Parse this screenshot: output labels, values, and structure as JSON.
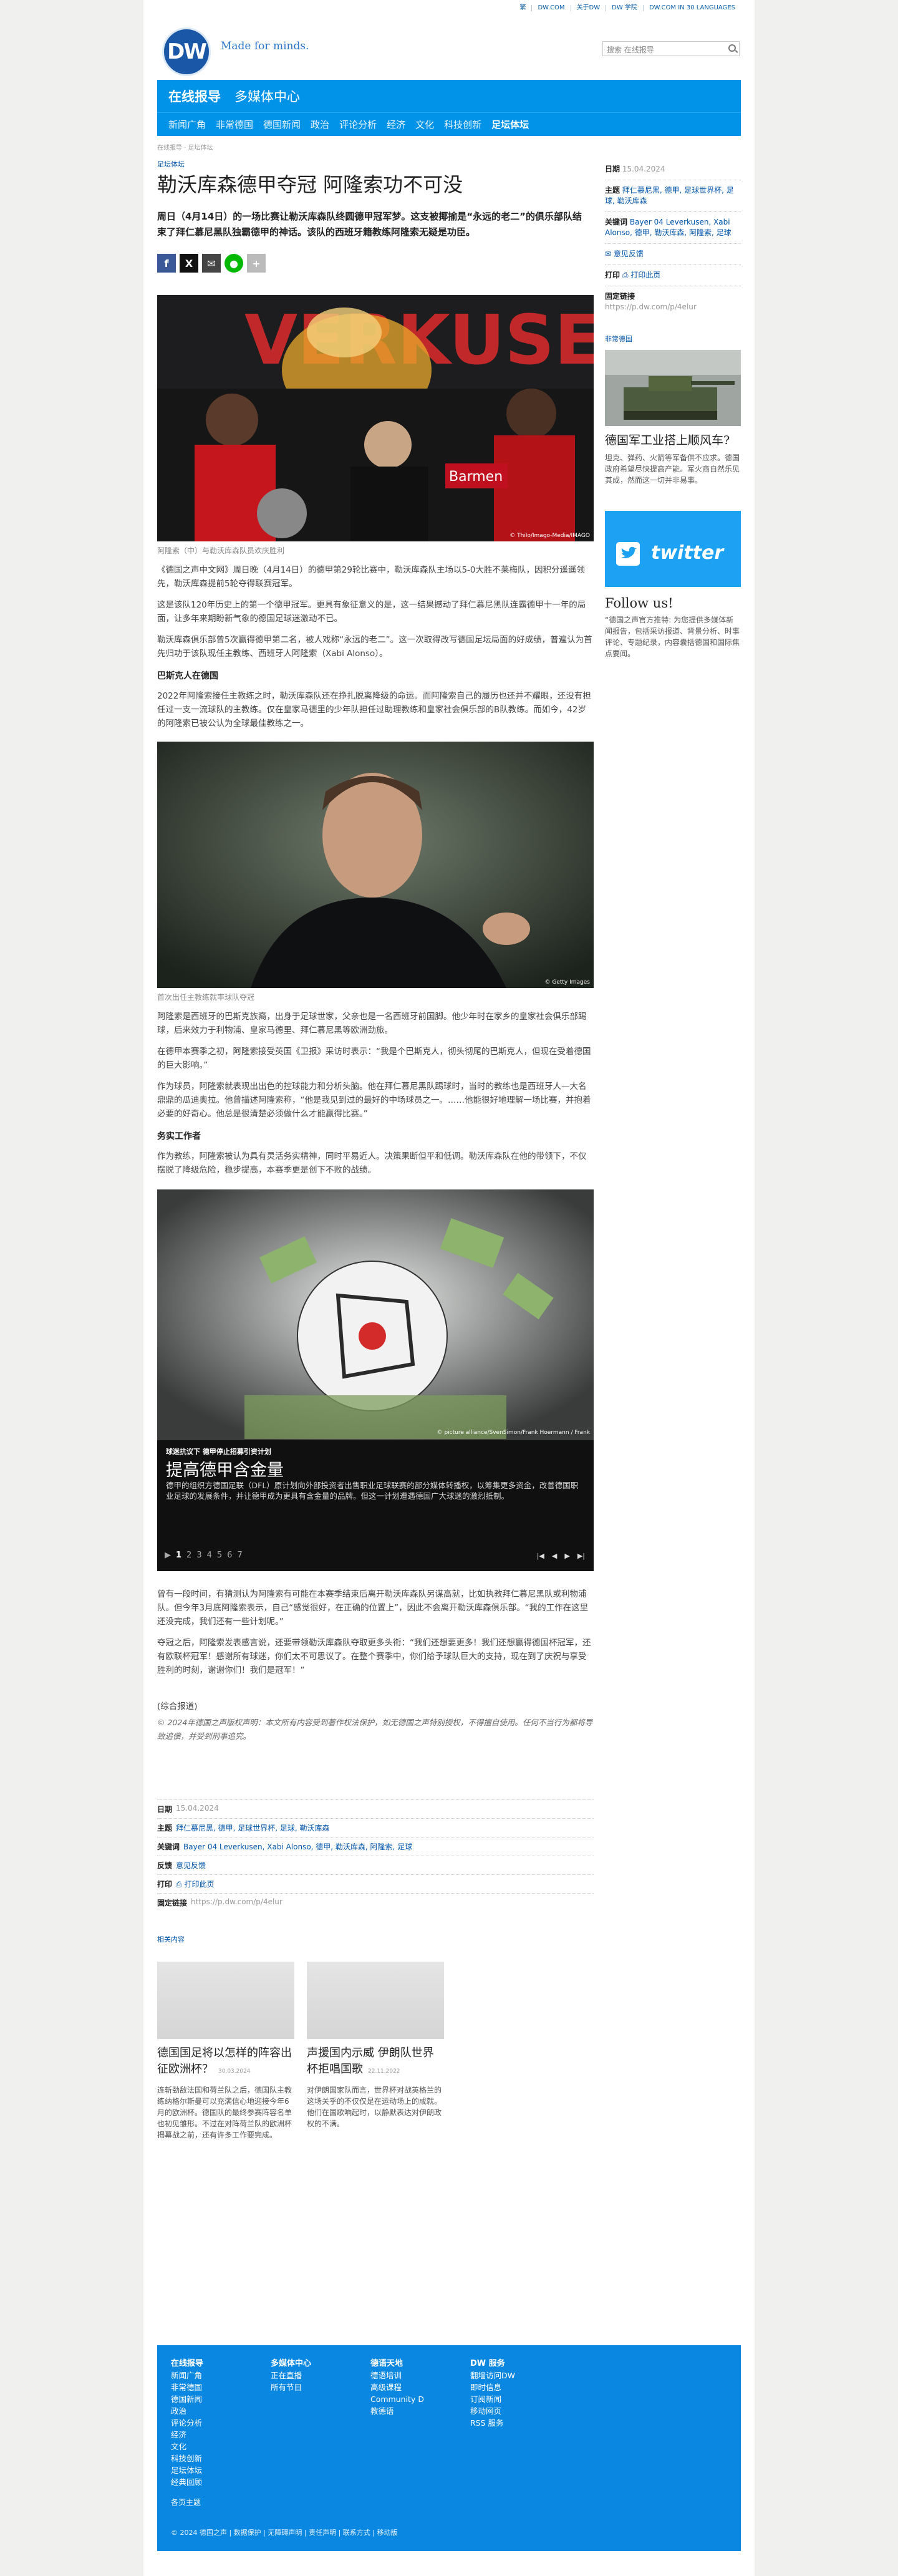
{
  "toplinks": [
    "繁",
    "DW.COM",
    "关于DW",
    "DW 学院",
    "DW.COM IN 30 LANGUAGES"
  ],
  "header": {
    "tagline": "Made for minds.",
    "search_placeholder": "搜索 在线报导",
    "logo": "DW"
  },
  "nav": {
    "top": [
      "在线报导",
      "多媒体中心"
    ],
    "sub": [
      "新闻广角",
      "非常德国",
      "德国新闻",
      "政治",
      "评论分析",
      "经济",
      "文化",
      "科技创新",
      "足坛体坛"
    ]
  },
  "breadcrumb": "在线报导 · 足坛体坛",
  "article": {
    "kicker": "足坛体坛",
    "title": "勒沃库森德甲夺冠 阿隆索功不可没",
    "lead": "周日（4月14日）的一场比赛让勒沃库森队终圆德甲冠军梦。这支被揶揄是“永远的老二”的俱乐部队结束了拜仁慕尼黑队独霸德甲的神话。该队的西班牙籍教练阿隆索无疑是功臣。",
    "photo1_caption": "阿隆索（中）与勒沃库森队员欢庆胜利",
    "photo1_credit": "© Thilo/Imago-Media/IMAGO",
    "p1": "《德国之声中文网》周日晚（4月14日）的德甲第29轮比赛中，勒沃库森队主场以5-0大胜不莱梅队，因积分遥遥领先，勒沃库森提前5轮夺得联赛冠军。",
    "p2": "这是该队120年历史上的第一个德甲冠军。更具有象征意义的是，这一结果撼动了拜仁慕尼黑队连霸德甲十一年的局面，让多年来期盼新气象的德国足球迷激动不已。",
    "p3": "勒沃库森俱乐部曾5次赢得德甲第二名，被人戏称“永远的老二”。这一次取得改写德国足坛局面的好成绩，普遍认为首先归功于该队现任主教练、西班牙人阿隆索（Xabi Alonso）。",
    "h_1": "巴斯克人在德国",
    "p4": "2022年阿隆索接任主教练之时，勒沃库森队还在挣扎脱离降级的命运。而阿隆索自己的履历也还并不耀眼，还没有担任过一支一流球队的主教练。仅在皇家马德里的少年队担任过助理教练和皇家社会俱乐部的B队教练。而如今，42岁的阿隆索已被公认为全球最佳教练之一。",
    "photo2_caption": "首次出任主教练就率球队夺冠",
    "photo2_credit": "© Getty Images",
    "p5": "阿隆索是西班牙的巴斯克族裔，出身于足球世家，父亲也是一名西班牙前国脚。他少年时在家乡的皇家社会俱乐部踢球，后来效力于利物浦、皇家马德里、拜仁慕尼黑等欧洲劲旅。",
    "p6": "在德甲本赛季之初，阿隆索接受英国《卫报》采访时表示：“我是个巴斯克人，彻头彻尾的巴斯克人，但现在受着德国的巨大影响。”",
    "p7": "作为球员，阿隆索就表现出出色的控球能力和分析头脑。他在拜仁慕尼黑队踢球时，当时的教练也是西班牙人—大名鼎鼎的瓜迪奥拉。他曾描述阿隆索称，“他是我见到过的最好的中场球员之一。……他能很好地理解一场比赛，并抱着必要的好奇心。他总是很清楚必须做什么才能赢得比赛。”",
    "h_2": "务实工作者",
    "p8": "作为教练，阿隆索被认为具有灵活务实精神，同时平易近人。决策果断但平和低调。勒沃库森队在他的带领下，不仅摆脱了降级危险，稳步提高，本赛季更是创下不败的战绩。",
    "gallery": {
      "kicker": "球迷抗议下 德甲停止招募引资计划",
      "title": "提高德甲含金量",
      "text": "德甲的组织方德国足联（DFL）原计划向外部投资者出售职业足球联赛的部分媒体转播权，以筹集更多资金，改善德国职业足球的发展条件，并让德甲成为更具有含金量的品牌。但这一计划遭遇德国广大球迷的激烈抵制。",
      "credit": "© picture alliance/SvenSimon/Frank Hoermann / Frank",
      "pages": [
        "1",
        "2",
        "3",
        "4",
        "5",
        "6",
        "7"
      ],
      "current_page": "1"
    },
    "p9": "曾有一段时间，有猜测认为阿隆索有可能在本赛季结束后离开勒沃库森队另谋高就，比如执教拜仁慕尼黑队或利物浦队。但今年3月底阿隆索表示，自己“感觉很好，在正确的位置上”，因此不会离开勒沃库森俱乐部。“我的工作在这里还没完成，我们还有一些计划呢。”",
    "p10": "夺冠之后，阿隆索发表感言说，还要带领勒沃库森队夺取更多头衔：“我们还想要更多！我们还想赢得德国杯冠军，还有欧联杯冠军！感谢所有球迷，你们太不可思议了。在整个赛季中，你们给予球队巨大的支持，现在到了庆祝与享受胜利的时刻，谢谢你们！我们是冠军！”",
    "source": "(综合报道)",
    "copyright": "© 2024年德国之声版权声明：本文所有内容受到著作权法保护，如无德国之声特别授权，不得擅自使用。任何不当行为都将导致追偿，并受到刑事追究。"
  },
  "info": {
    "date_label": "日期",
    "date": "15.04.2024",
    "topics_label": "主题",
    "topics": "拜仁慕尼黑, 德甲, 足球世界杯, 足球, 勒沃库森",
    "keywords_label": "关键词",
    "keywords": "Bayer 04 Leverkusen, Xabi Alonso, 德甲, 勒沃库森, 阿隆索, 足球",
    "feedback_label": "反馈",
    "feedback": "意见反馈",
    "print_label": "打印",
    "print": "打印此页",
    "permalink_label": "固定链接",
    "permalink": "https://p.dw.com/p/4elur"
  },
  "side_info": {
    "topics": "拜仁慕尼黑, 德甲, 足球世界杯, 足球, 勒沃库森",
    "keywords": "Bayer 04 Leverkusen, Xabi Alonso, 德甲, 勒沃库森, 阿隆索, 足球",
    "feedback": "意见反馈",
    "print": "打印此页"
  },
  "side": {
    "heading": "非常德国",
    "teaser_title": "德国军工业搭上顺风车?",
    "teaser_text": "坦克、弹药、火箭等军备供不应求。德国政府希望尽快提高产能。军火商自然乐见其成，然而这一切并非易事。",
    "twitter_word": "twitter",
    "follow": "Follow us!",
    "follow_text": "“德国之声官方推特: 为您提供多媒体新闻报告，包括采访报道、背景分析、时事评论、专题纪录，内容囊括德国和国际焦点要闻。"
  },
  "related": {
    "heading": "相关内容",
    "items": [
      {
        "title": "德国国足将以怎样的阵容出征欧洲杯？",
        "date": "30.03.2024",
        "text": "连斩劲敌法国和荷兰队之后，德国队主教练纳格尔斯曼可以充满信心地迎接今年6月的欧洲杯。德国队的最终参赛阵容名单也初见雏形。不过在对阵荷兰队的欧洲杯揭幕战之前，还有许多工作要完成。"
      },
      {
        "title": "声援国内示威 伊朗队世界杯拒唱国歌",
        "date": "22.11.2022",
        "text": "对伊朗国家队而言，世界杯对战英格兰的这场关乎的不仅仅是在运动场上的成就。他们在国歌响起时，以静默表达对伊朗政权的不满。"
      }
    ]
  },
  "footer": {
    "cols": [
      {
        "head": "在线报导",
        "items": [
          "新闻广角",
          "非常德国",
          "德国新闻",
          "政治",
          "评论分析",
          "经济",
          "文化",
          "科技创新",
          "足坛体坛",
          "经典回顾"
        ]
      },
      {
        "head": "多媒体中心",
        "items": [
          "正在直播",
          "所有节目"
        ]
      },
      {
        "head": "德语天地",
        "items": [
          "德语培训",
          "高级课程",
          "Community D",
          "教德语"
        ]
      },
      {
        "head": "DW 服务",
        "items": [
          "翻墙访问DW",
          "即时信息",
          "订阅新闻",
          "移动网页",
          "RSS 服务"
        ]
      }
    ],
    "home": "各页主题",
    "bottom": "© 2024 德国之声 | 数据保护 | 无障碍声明 | 责任声明 | 联系方式 | 移动版"
  }
}
